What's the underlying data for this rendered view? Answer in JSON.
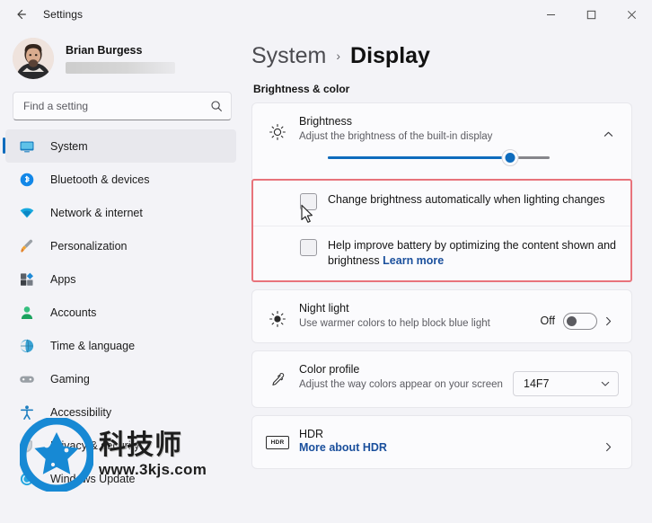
{
  "window": {
    "title": "Settings",
    "back_icon": "back-arrow-icon",
    "minimize_label": "—",
    "maximize_label": "□",
    "close_label": "✕"
  },
  "account": {
    "name": "Brian Burgess",
    "email_redacted": true
  },
  "search": {
    "placeholder": "Find a setting",
    "value": "",
    "icon": "search-icon"
  },
  "sidebar": {
    "items": [
      {
        "label": "System",
        "icon": "monitor-icon",
        "active": true
      },
      {
        "label": "Bluetooth & devices",
        "icon": "bluetooth-icon",
        "active": false
      },
      {
        "label": "Network & internet",
        "icon": "wifi-icon",
        "active": false
      },
      {
        "label": "Personalization",
        "icon": "paintbrush-icon",
        "active": false
      },
      {
        "label": "Apps",
        "icon": "apps-icon",
        "active": false
      },
      {
        "label": "Accounts",
        "icon": "person-icon",
        "active": false
      },
      {
        "label": "Time & language",
        "icon": "globe-clock-icon",
        "active": false
      },
      {
        "label": "Gaming",
        "icon": "gamepad-icon",
        "active": false
      },
      {
        "label": "Accessibility",
        "icon": "accessibility-icon",
        "active": false
      },
      {
        "label": "Privacy & security",
        "icon": "shield-icon",
        "active": false
      },
      {
        "label": "Windows Update",
        "icon": "update-icon",
        "active": false
      }
    ]
  },
  "breadcrumb": {
    "parent": "System",
    "separator": "›",
    "current": "Display"
  },
  "main": {
    "section_label": "Brightness & color",
    "brightness": {
      "title": "Brightness",
      "subtitle": "Adjust the brightness of the built-in display",
      "icon": "brightness-sun-icon",
      "expand_icon": "chevron-up-icon",
      "slider_percent": 82
    },
    "auto_brightness": {
      "label": "Change brightness automatically when lighting changes",
      "checked": false,
      "cursor_present": true
    },
    "content_adaptive": {
      "label": "Help improve battery by optimizing the content shown and brightness",
      "link_text": "Learn more",
      "checked": false
    },
    "night_light": {
      "title": "Night light",
      "subtitle": "Use warmer colors to help block blue light",
      "icon": "night-light-icon",
      "toggle_label": "Off",
      "toggle_on": false,
      "chevron_icon": "chevron-right-icon"
    },
    "color_profile": {
      "title": "Color profile",
      "subtitle": "Adjust the way colors appear on your screen",
      "icon": "eyedropper-icon",
      "selected_value": "14F7",
      "chevron_icon": "chevron-down-icon"
    },
    "hdr": {
      "title": "HDR",
      "badge_text": "HDR",
      "link_text": "More about HDR",
      "icon": "hdr-badge-icon",
      "chevron_icon": "chevron-right-icon"
    }
  },
  "watermark": {
    "chinese_text": "科技师",
    "url_text": "www.3kjs.com",
    "logo_color": "#1789d4"
  },
  "colors": {
    "accent": "#0f6cbd",
    "highlight_border": "#e8737b",
    "link": "#1a4f9c",
    "background": "#f3f3f7",
    "card": "#fbfbfd"
  }
}
